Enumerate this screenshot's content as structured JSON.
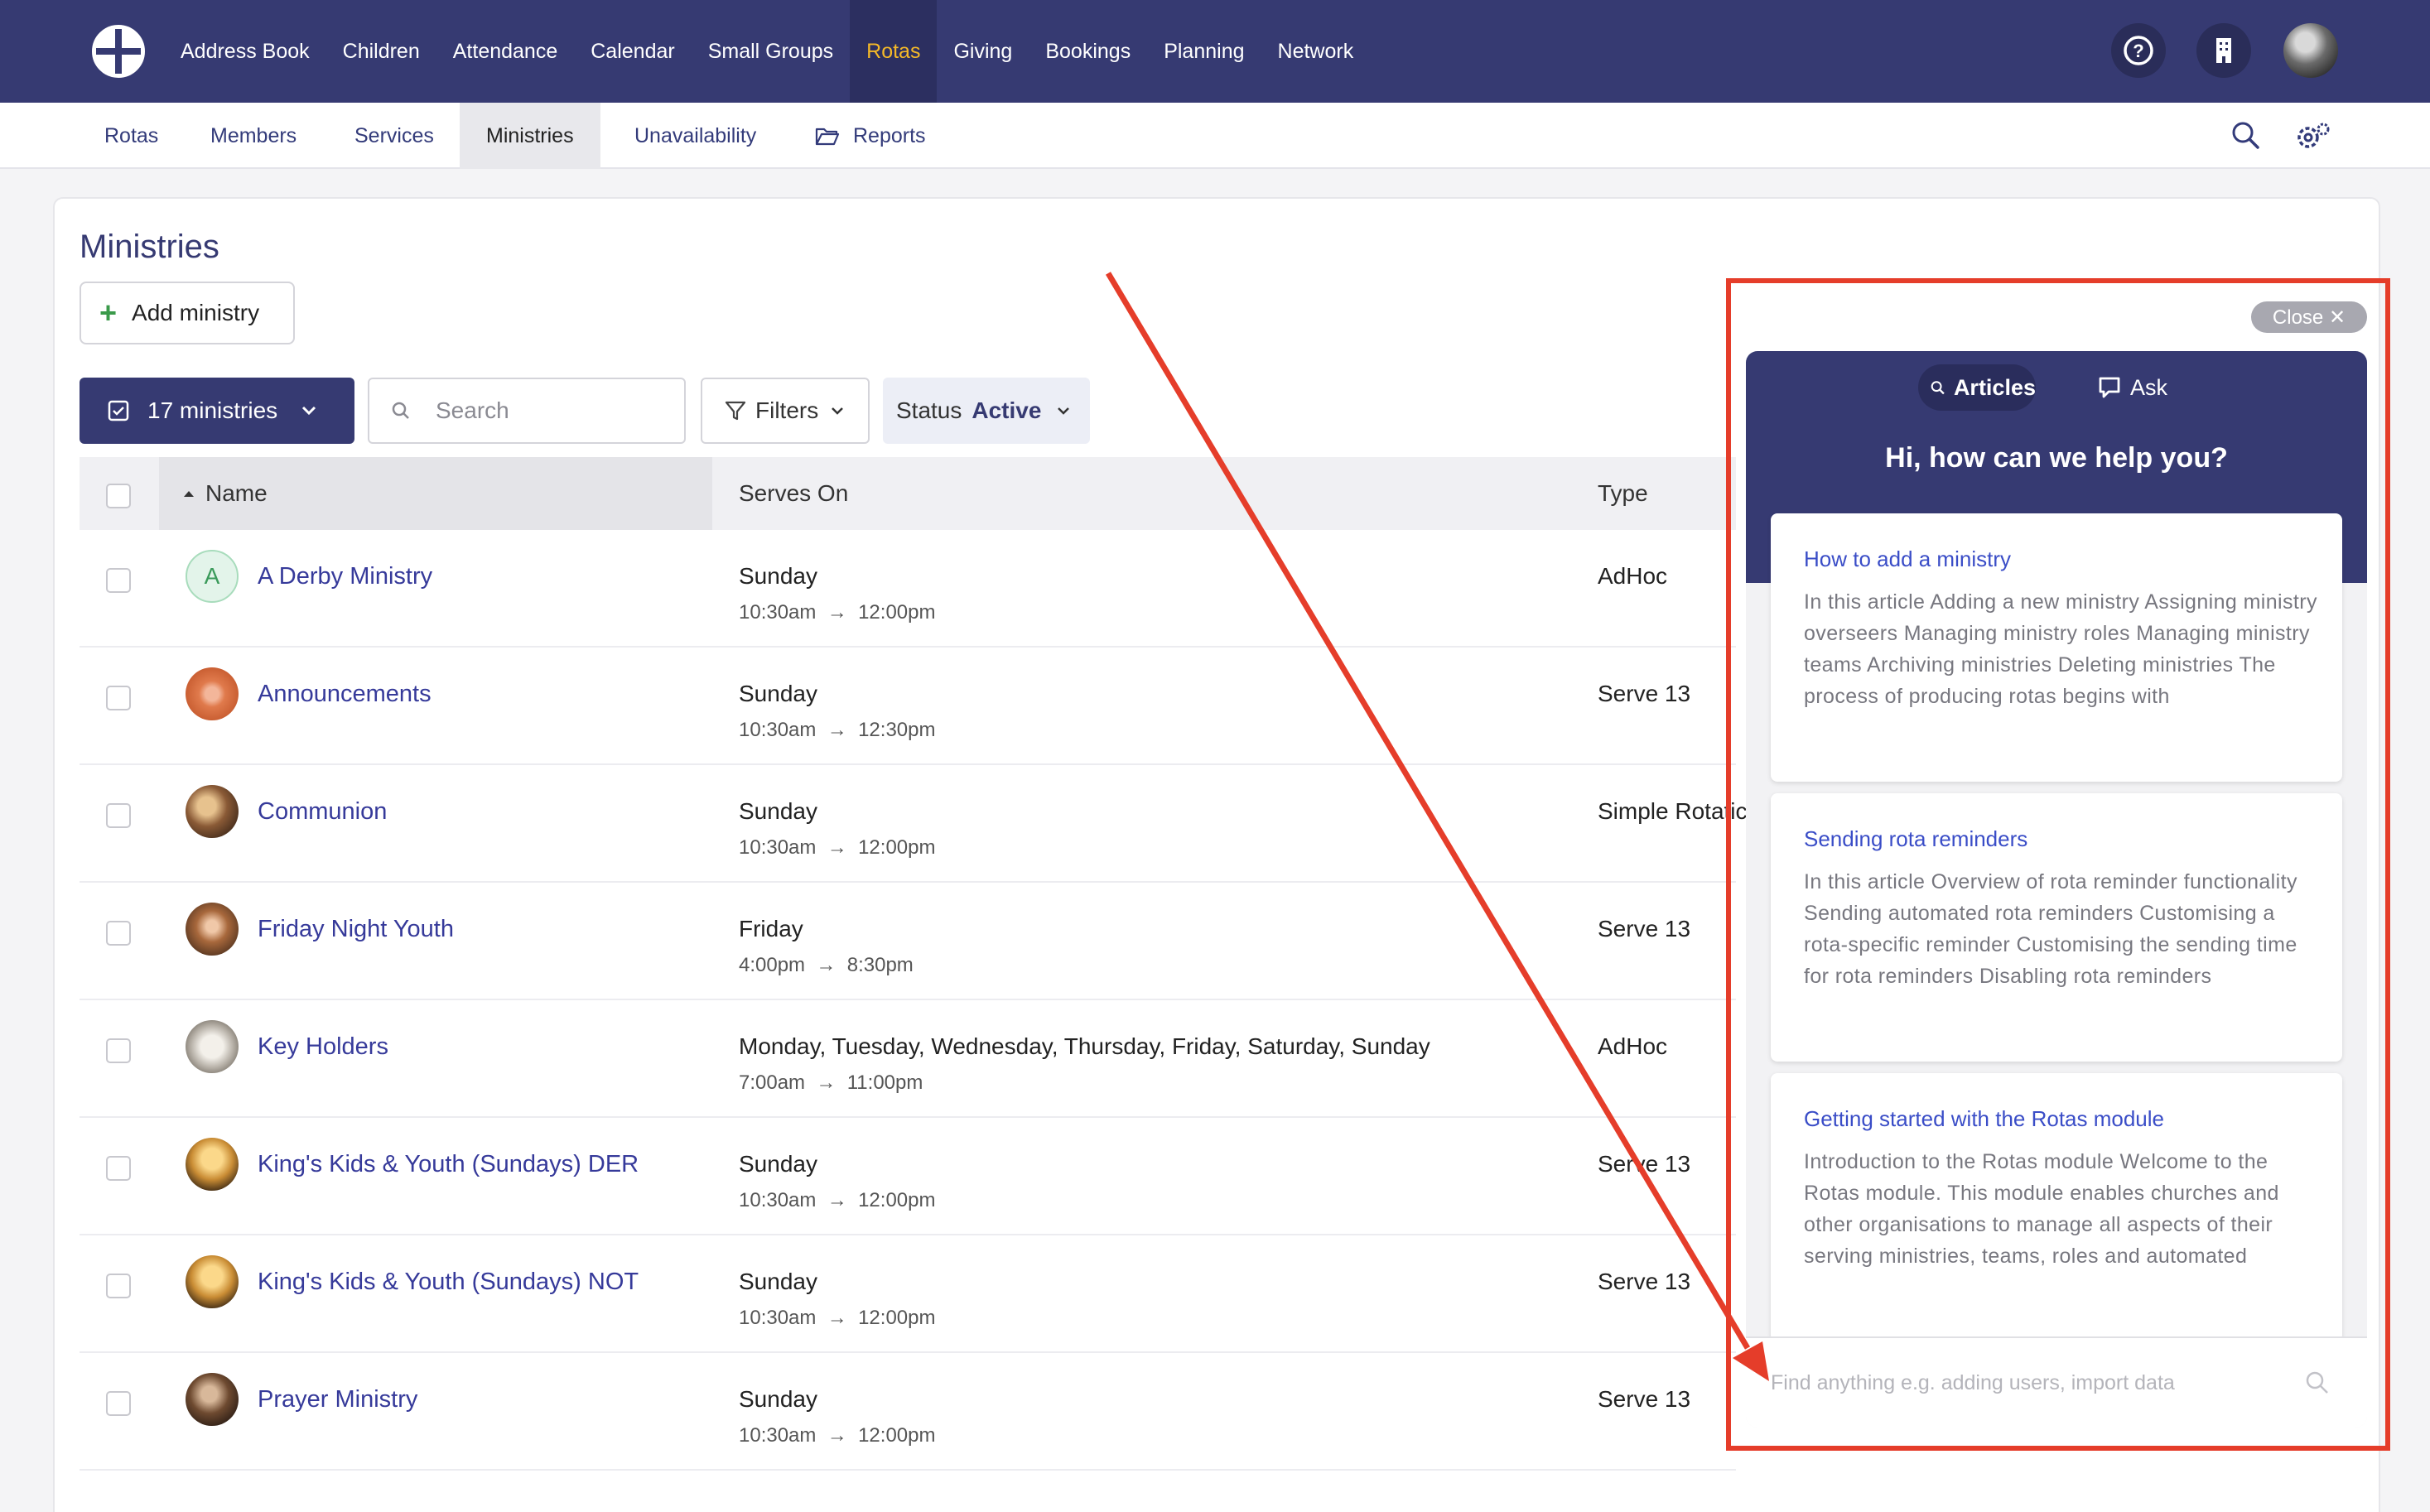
{
  "nav": {
    "items": [
      "Address Book",
      "Children",
      "Attendance",
      "Calendar",
      "Small Groups",
      "Rotas",
      "Giving",
      "Bookings",
      "Planning",
      "Network"
    ],
    "active": "Rotas",
    "icons": [
      "help-icon",
      "building-icon",
      "avatar"
    ]
  },
  "subnav": {
    "items": [
      "Rotas",
      "Members",
      "Services",
      "Ministries",
      "Unavailability",
      "Reports"
    ],
    "active": "Ministries"
  },
  "page": {
    "title": "Ministries",
    "add_label": "Add ministry",
    "count_label": "17 ministries",
    "search_placeholder": "Search",
    "filters_label": "Filters",
    "status_label": "Status",
    "status_value": "Active"
  },
  "table": {
    "headers": {
      "name": "Name",
      "serves_on": "Serves On",
      "type": "Type"
    },
    "rows": [
      {
        "name": "A Derby Ministry",
        "day": "Sunday",
        "start": "10:30am",
        "end": "12:00pm",
        "type": "AdHoc",
        "avatar": "letter",
        "letter": "A"
      },
      {
        "name": "Announcements",
        "day": "Sunday",
        "start": "10:30am",
        "end": "12:30pm",
        "type": "Serve 13",
        "avatar": "image"
      },
      {
        "name": "Communion",
        "day": "Sunday",
        "start": "10:30am",
        "end": "12:00pm",
        "type": "Simple Rotatic",
        "avatar": "image"
      },
      {
        "name": "Friday Night Youth",
        "day": "Friday",
        "start": "4:00pm",
        "end": "8:30pm",
        "type": "Serve 13",
        "avatar": "image"
      },
      {
        "name": "Key Holders",
        "day": "Monday, Tuesday, Wednesday, Thursday, Friday, Saturday, Sunday",
        "start": "7:00am",
        "end": "11:00pm",
        "type": "AdHoc",
        "avatar": "image"
      },
      {
        "name": "King's Kids & Youth (Sundays) DER",
        "day": "Sunday",
        "start": "10:30am",
        "end": "12:00pm",
        "type": "Serve 13",
        "avatar": "image"
      },
      {
        "name": "King's Kids & Youth (Sundays) NOT",
        "day": "Sunday",
        "start": "10:30am",
        "end": "12:00pm",
        "type": "Serve 13",
        "avatar": "image"
      },
      {
        "name": "Prayer Ministry",
        "day": "Sunday",
        "start": "10:30am",
        "end": "12:00pm",
        "type": "Serve 13",
        "avatar": "image"
      }
    ]
  },
  "help": {
    "close_label": "Close ✕",
    "tab_articles": "Articles",
    "tab_ask": "Ask",
    "title": "Hi, how can we help you?",
    "articles": [
      {
        "title": "How to add a ministry",
        "body": "In this article Adding a new ministry Assigning ministry overseers Managing ministry roles Managing ministry teams Archiving ministries Deleting ministries The process of producing rotas begins with"
      },
      {
        "title": "Sending rota reminders",
        "body": "In this article Overview of rota reminder functionality Sending automated rota reminders Customising a rota-specific reminder Customising the sending time for rota reminders Disabling rota reminders"
      },
      {
        "title": "Getting started with the Rotas module",
        "body": "Introduction to the Rotas module Welcome to the Rotas module. This module enables churches and other organisations to manage all aspects of their serving ministries, teams, roles and automated"
      }
    ],
    "search_placeholder": "Find anything e.g. adding users, import data"
  },
  "colors": {
    "navy": "#363a72",
    "accent": "#f5b928",
    "link": "#363a9a",
    "annotation_red": "#e53d2a"
  }
}
